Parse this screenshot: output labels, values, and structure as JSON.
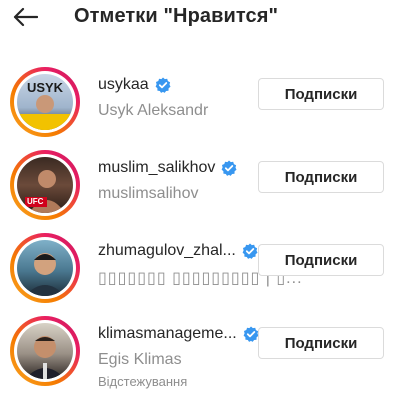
{
  "header": {
    "title": "Отметки \"Нравится\"",
    "back_icon": "arrow-left-icon"
  },
  "users": [
    {
      "username": "usykaa",
      "full_name": "Usyk Aleksandr",
      "subtext": "",
      "verified": true,
      "button_label": "Подписки",
      "avatar_text": "USYK"
    },
    {
      "username": "muslim_salikhov",
      "full_name": "muslimsalihov",
      "subtext": "",
      "verified": true,
      "button_label": "Подписки",
      "avatar_text": "UFC"
    },
    {
      "username": "zhumagulov_zhal...",
      "full_name": "▯▯▯▯▯▯▯ ▯▯▯▯▯▯▯▯▯ | ▯...",
      "subtext": "",
      "verified": true,
      "button_label": "Подписки",
      "avatar_text": ""
    },
    {
      "username": "klimasmanageme...",
      "full_name": "Egis Klimas",
      "subtext": "Відстежування",
      "verified": true,
      "button_label": "Подписки",
      "avatar_text": ""
    }
  ],
  "colors": {
    "verified_blue": "#3897f0",
    "ring_start": "#f9a825",
    "ring_end": "#c2185b",
    "secondary_text": "#8e8e8e",
    "border": "#dbdbdb"
  }
}
